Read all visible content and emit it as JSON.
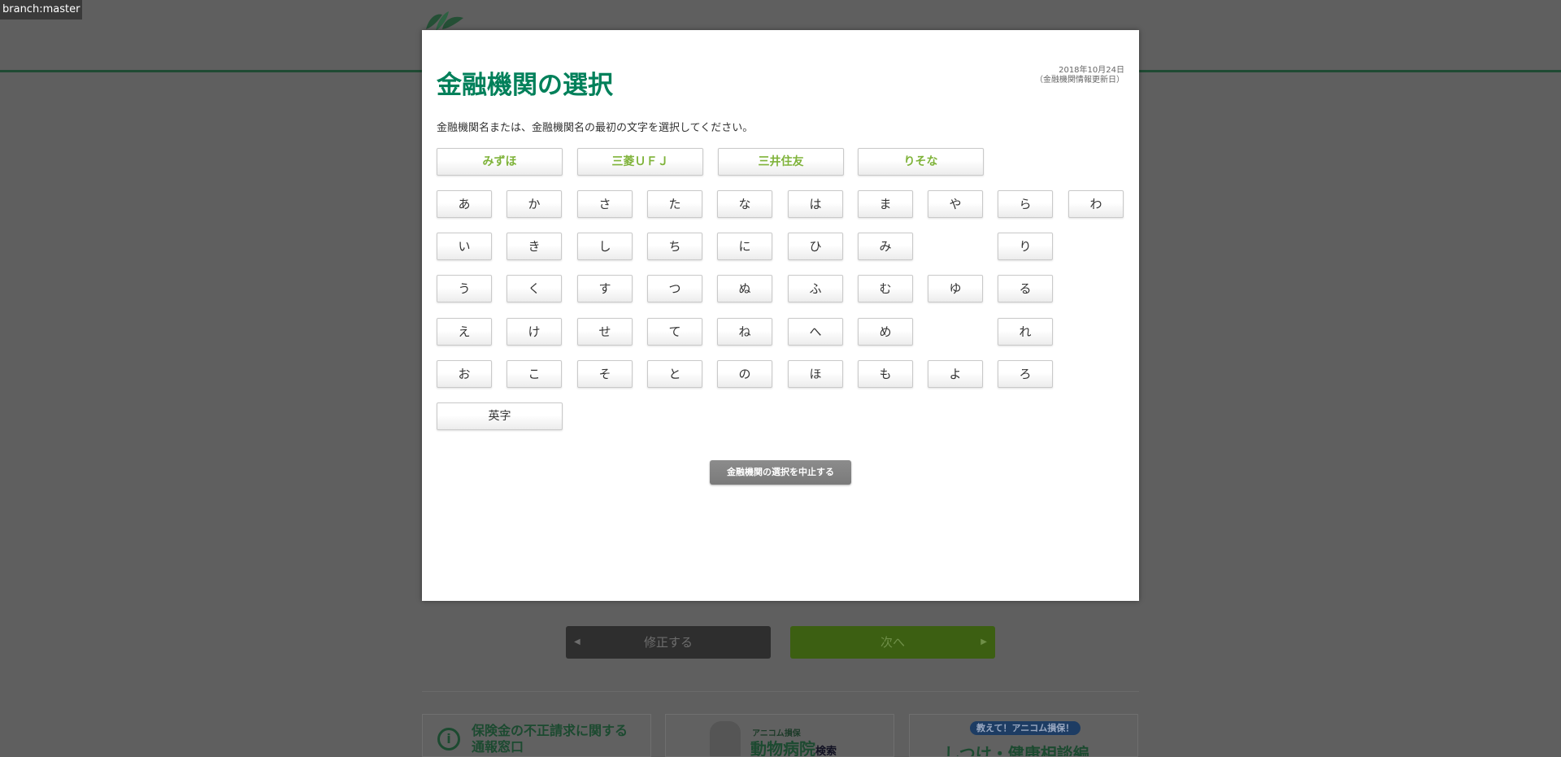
{
  "branch_badge": "branch:master",
  "modal": {
    "title": "金融機関の選択",
    "date_line1": "2018年10月24日",
    "date_line2": "（金融機関情報更新日）",
    "instruction": "金融機関名または、金融機関名の最初の文字を選択してください。",
    "major_banks": [
      "みずほ",
      "三菱ＵＦＪ",
      "三井住友",
      "りそな"
    ],
    "kana_rows": [
      [
        "あ",
        "か",
        "さ",
        "た",
        "な",
        "は",
        "ま",
        "や",
        "ら",
        "わ"
      ],
      [
        "い",
        "き",
        "し",
        "ち",
        "に",
        "ひ",
        "み",
        "",
        "り",
        ""
      ],
      [
        "う",
        "く",
        "す",
        "つ",
        "ぬ",
        "ふ",
        "む",
        "ゆ",
        "る",
        ""
      ],
      [
        "え",
        "け",
        "せ",
        "て",
        "ね",
        "へ",
        "め",
        "",
        "れ",
        ""
      ],
      [
        "お",
        "こ",
        "そ",
        "と",
        "の",
        "ほ",
        "も",
        "よ",
        "ろ",
        ""
      ]
    ],
    "eiji_label": "英字",
    "cancel_label": "金融機関の選択を中止する"
  },
  "background": {
    "back_label": "修正する",
    "next_label": "次へ",
    "banner1_line1": "保険金の不正請求に関する",
    "banner1_line2": "通報窓口",
    "banner2_small": "アニコム損保",
    "banner2_main": "動物病院",
    "banner2_suffix": "検索",
    "banner3_pill": "教えて！アニコム損保！",
    "banner3_main": "しつけ・健康相談編"
  },
  "colors": {
    "title_green": "#00805a",
    "major_bank_green": "#7fb33a",
    "overlay": "#5f5f5f"
  }
}
